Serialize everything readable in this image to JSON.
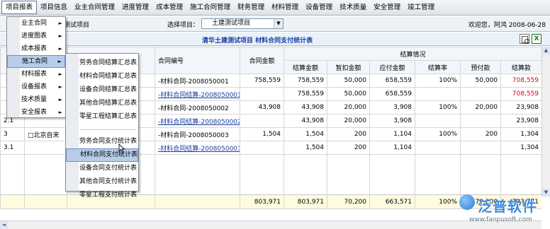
{
  "menubar": [
    "项目报表",
    "项目信息",
    "业主合同管理",
    "进度管理",
    "成本管理",
    "施工合同管理",
    "财务管理",
    "材料管理",
    "设备管理",
    "技术质量",
    "安全管理",
    "竣工管理"
  ],
  "subbar": {
    "current_project": "测试项目",
    "project_label": "选择项目：",
    "project_value": "土建测试项目",
    "welcome": "欢迎您，阿鸿 2008-06-28"
  },
  "report": {
    "title": "清华土建测试项目  材料合同支付统计表"
  },
  "table": {
    "headers": {
      "contract_no": "合同编号",
      "contract_amount": "合同金额",
      "settlement_group": "结算情况",
      "settle_amount": "结算金额",
      "deduct": "暂扣金额",
      "payable": "应付金额",
      "settle_rate": "结算率",
      "prepay": "预付款",
      "settle_payment": "结算款"
    },
    "rows": [
      {
        "no": "",
        "name": "",
        "contract": "-材料合同-2008050001",
        "amount": "758,559",
        "settle": "758,559",
        "deduct": "50,000",
        "payable": "658,559",
        "rate": "100%",
        "prepay": "50,000",
        "payment": "708,559",
        "link": false,
        "red": true
      },
      {
        "no": "",
        "name": "",
        "contract": "-材料合同结算-2008050001",
        "amount": "",
        "settle": "758,559",
        "deduct": "50,000",
        "payable": "658,559",
        "rate": "",
        "prepay": "",
        "payment": "708,559",
        "link": true,
        "red": true
      },
      {
        "no": "",
        "name": "",
        "contract": "-材料合同-2008050002",
        "amount": "43,908",
        "settle": "43,908",
        "deduct": "20,000",
        "payable": "3,908",
        "rate": "100%",
        "prepay": "20,000",
        "payment": "23,908",
        "link": false,
        "red": false
      },
      {
        "no": "2.1",
        "name": "",
        "contract": "-材料合同结算-2008050002",
        "amount": "",
        "settle": "43,908",
        "deduct": "20,000",
        "payable": "3,908",
        "rate": "",
        "prepay": "",
        "payment": "23,908",
        "link": true,
        "red": false
      },
      {
        "no": "3",
        "name": "北京自来",
        "contract": "-材料合同-2008050003",
        "amount": "1,504",
        "settle": "1,504",
        "deduct": "200",
        "payable": "1,104",
        "rate": "100%",
        "prepay": "200",
        "payment": "1,304",
        "link": false,
        "red": false,
        "expander": "□"
      },
      {
        "no": "3.1",
        "name": "",
        "contract": "-材料合同结算-2008050003",
        "amount": "",
        "settle": "1,504",
        "deduct": "200",
        "payable": "1,104",
        "rate": "",
        "prepay": "",
        "payment": "1,304",
        "link": true,
        "red": false
      }
    ],
    "totals": {
      "amount": "803,971",
      "settle": "803,971",
      "deduct": "70,200",
      "payable": "663,571",
      "rate": "100%",
      "prepay": "70,200",
      "payment": "733,771"
    }
  },
  "menu_main": [
    {
      "label": "业主合同",
      "arrow": "►"
    },
    {
      "label": "进度图表",
      "arrow": "►"
    },
    {
      "label": "成本报表",
      "arrow": "►"
    },
    {
      "label": "施工合同",
      "arrow": "►",
      "active": true
    },
    {
      "label": "材料报表",
      "arrow": "►"
    },
    {
      "label": "设备报表",
      "arrow": "►"
    },
    {
      "label": "技术质量",
      "arrow": "►"
    },
    {
      "label": "安全报表",
      "arrow": "►"
    }
  ],
  "menu_sub": [
    {
      "label": "劳务合同结算汇总表"
    },
    {
      "label": "材料合同结算汇总表"
    },
    {
      "label": "设备合同结算汇总表"
    },
    {
      "label": "其他合同结算汇总表"
    },
    {
      "label": "零星工程结算汇总表"
    },
    {
      "label": "劳务合同支付统计表"
    },
    {
      "label": "材料合同支付统计表",
      "active": true
    },
    {
      "label": "设备合同支付统计表"
    },
    {
      "label": "其他合同支付统计表"
    },
    {
      "label": "零星工程支付统计表"
    }
  ],
  "logo": {
    "text": "泛普软件",
    "url": "www.fanpusoft.com"
  },
  "colors": {
    "accent": "#1c40a0",
    "link": "#1c3d9c",
    "highlight": "#e0001a",
    "menu_hover": "#b7cdea"
  }
}
